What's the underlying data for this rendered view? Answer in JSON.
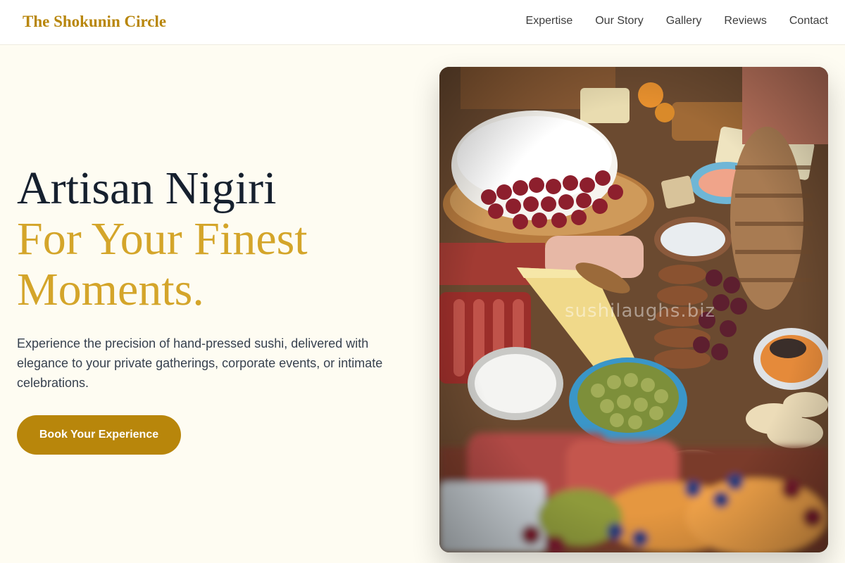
{
  "header": {
    "brand": "The Shokunin Circle",
    "nav": [
      "Expertise",
      "Our Story",
      "Gallery",
      "Reviews",
      "Contact"
    ]
  },
  "hero": {
    "headline_line1": "Artisan Nigiri",
    "headline_line2": "For Your Finest",
    "headline_line3": "Moments.",
    "description": "Experience the precision of hand-pressed sushi, delivered with elegance to your private gatherings, corporate events, or intimate celebrations.",
    "cta_label": "Book Your Experience",
    "image_watermark": "sushilaughs.biz"
  },
  "colors": {
    "brand_gold": "#b8860b",
    "headline_gold": "#d4a52a",
    "headline_dark": "#16202e",
    "page_background": "#fefcf2"
  }
}
